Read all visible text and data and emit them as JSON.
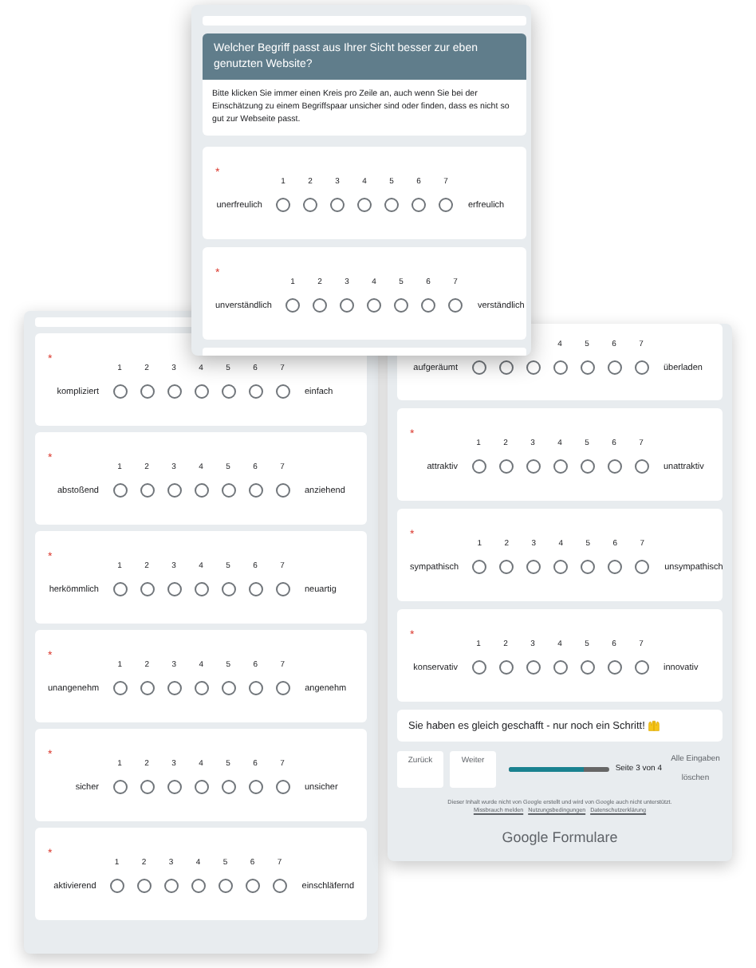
{
  "left_panel": {
    "items": [
      {
        "left": "kompliziert",
        "right": "einfach",
        "mark": "*",
        "scale": [
          "1",
          "2",
          "3",
          "4",
          "5",
          "6",
          "7"
        ],
        "selected": [
          false,
          false,
          false,
          false,
          false,
          false,
          false
        ]
      },
      {
        "left": "abstoßend",
        "right": "anziehend",
        "mark": "*",
        "scale": [
          "1",
          "2",
          "3",
          "4",
          "5",
          "6",
          "7"
        ],
        "selected": [
          false,
          false,
          false,
          false,
          false,
          false,
          false
        ]
      },
      {
        "left": "herkömmlich",
        "right": "neuartig",
        "mark": "*",
        "scale": [
          "1",
          "2",
          "3",
          "4",
          "5",
          "6",
          "7"
        ],
        "selected": [
          false,
          false,
          false,
          false,
          false,
          false,
          false
        ]
      },
      {
        "left": "unangenehm",
        "right": "angenehm",
        "mark": "*",
        "scale": [
          "1",
          "2",
          "3",
          "4",
          "5",
          "6",
          "7"
        ],
        "selected": [
          false,
          false,
          false,
          false,
          false,
          false,
          false
        ]
      },
      {
        "left": "sicher",
        "right": "unsicher",
        "mark": "*",
        "scale": [
          "1",
          "2",
          "3",
          "4",
          "5",
          "6",
          "7"
        ],
        "selected": [
          false,
          false,
          false,
          false,
          false,
          false,
          false
        ]
      },
      {
        "left": "aktivierend",
        "right": "einschläfernd",
        "mark": "*",
        "scale": [
          "1",
          "2",
          "3",
          "4",
          "5",
          "6",
          "7"
        ],
        "selected": [
          false,
          false,
          false,
          false,
          false,
          false,
          false
        ]
      }
    ]
  },
  "right_panel": {
    "items": [
      {
        "left": "aufgeräumt",
        "right": "überladen",
        "scale": [
          "4",
          "5",
          "6",
          "7"
        ],
        "selected": [
          false,
          false,
          false,
          false,
          false,
          false,
          false
        ]
      },
      {
        "left": "attraktiv",
        "right": "unattraktiv",
        "mark": "*",
        "scale": [
          "1",
          "2",
          "3",
          "4",
          "5",
          "6",
          "7"
        ],
        "selected": [
          false,
          false,
          false,
          false,
          false,
          false,
          false
        ]
      },
      {
        "left": "sympathisch",
        "right": "unsympathisch",
        "mark": "*",
        "scale": [
          "1",
          "2",
          "3",
          "4",
          "5",
          "6",
          "7"
        ],
        "selected": [
          false,
          false,
          false,
          false,
          false,
          false,
          false
        ]
      },
      {
        "left": "konservativ",
        "right": "innovativ",
        "mark": "*",
        "scale": [
          "1",
          "2",
          "3",
          "4",
          "5",
          "6",
          "7"
        ],
        "selected": [
          false,
          false,
          false,
          false,
          false,
          false,
          false
        ]
      }
    ],
    "banner": "Sie haben es gleich geschafft - nur noch ein Schritt!",
    "buttons": [
      "Zurück",
      "Weiter"
    ],
    "progress": {
      "level": 0.75,
      "label": "Seite 3 von 4"
    },
    "clear_link": "Alle Eingaben löschen",
    "disclaimer": "Dieser Inhalt wurde nicht von Google erstellt und wird von Google auch nicht unterstützt.",
    "footer_links": [
      "Missbrauch melden",
      "Nutzungsbedingungen",
      "Datenschutzerklärung"
    ],
    "brand": "Google Formulare"
  },
  "top_panel": {
    "section_title": "Welcher Begriff passt aus Ihrer Sicht besser zur eben genutzten Website?",
    "description": "Bitte klicken Sie immer einen Kreis pro Zeile an, auch wenn Sie bei der Einschätzung zu einem Begriffspaar unsicher sind oder finden, dass es nicht so gut zur Webseite passt.",
    "items": [
      {
        "left": "unerfreulich",
        "right": "erfreulich",
        "mark": "*",
        "scale": [
          "1",
          "2",
          "3",
          "4",
          "5",
          "6",
          "7"
        ],
        "selected": [
          false,
          false,
          false,
          false,
          false,
          false,
          false
        ]
      },
      {
        "left": "unverständlich",
        "right": "verständlich",
        "mark": "*",
        "scale": [
          "1",
          "2",
          "3",
          "4",
          "5",
          "6",
          "7"
        ],
        "selected": [
          false,
          false,
          false,
          false,
          false,
          false,
          false
        ]
      }
    ]
  }
}
